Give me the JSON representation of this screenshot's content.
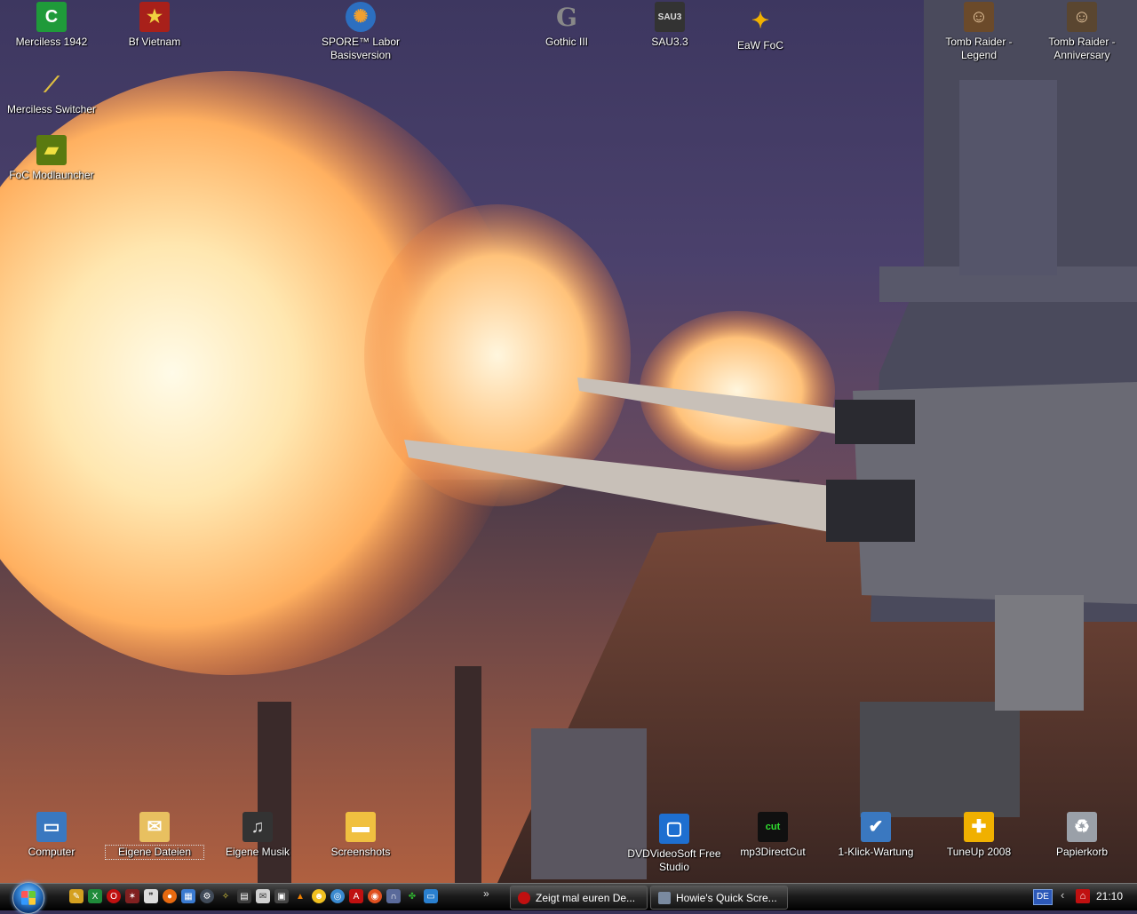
{
  "desktop": {
    "icons_top": [
      {
        "label": "Merciless 1942",
        "icon": "merciless-icon",
        "color": "#1f9a3a"
      },
      {
        "label": "Bf Vietnam",
        "icon": "battlefield-star-icon",
        "color": "#a8201a"
      },
      {
        "label": "SPORE™ Labor Basisversion",
        "icon": "spore-icon",
        "color": "#2c6fc0"
      },
      {
        "label": "Gothic III",
        "icon": "gothic-icon",
        "color": "#555555"
      },
      {
        "label": "SAU3.3",
        "icon": "sau3-icon",
        "color": "#333333"
      },
      {
        "label": "EaW FoC",
        "icon": "eaw-foc-icon",
        "color": "#c89000"
      },
      {
        "label": "Tomb Raider - Legend",
        "icon": "lara-portrait-icon",
        "color": "#6b4a2a"
      },
      {
        "label": "Tomb Raider - Anniversary",
        "icon": "lara-portrait-icon",
        "color": "#5a4630"
      },
      {
        "label": "Merciless Switcher",
        "icon": "wand-icon",
        "color": "#2a2a2a"
      },
      {
        "label": "FoC Modlauncher",
        "icon": "modlauncher-icon",
        "color": "#5a7a10"
      }
    ],
    "icons_bottom": [
      {
        "label": "Computer",
        "icon": "computer-icon",
        "color": "#3a78c0"
      },
      {
        "label": "Eigene Dateien",
        "icon": "documents-folder-icon",
        "color": "#e8c060"
      },
      {
        "label": "Eigene Musik",
        "icon": "music-icon",
        "color": "#333333"
      },
      {
        "label": "Screenshots",
        "icon": "folder-icon",
        "color": "#f0c040"
      },
      {
        "label": "DVDVideoSoft Free Studio",
        "icon": "dvdvideosoft-icon",
        "color": "#1e6fd0"
      },
      {
        "label": "mp3DirectCut",
        "icon": "mp3directcut-icon",
        "color": "#101010"
      },
      {
        "label": "1-Klick-Wartung",
        "icon": "maintenance-icon",
        "color": "#3a78c0"
      },
      {
        "label": "TuneUp 2008",
        "icon": "tuneup-icon",
        "color": "#f0b000"
      },
      {
        "label": "Papierkorb",
        "icon": "recycle-bin-icon",
        "color": "#9aa0a8"
      }
    ]
  },
  "taskbar": {
    "quicklaunch": [
      {
        "icon": "pencil-icon",
        "color": "#d4a020"
      },
      {
        "icon": "excel-icon",
        "color": "#1f8a3a"
      },
      {
        "icon": "opera-icon",
        "color": "#c01010"
      },
      {
        "icon": "game-icon",
        "color": "#802020"
      },
      {
        "icon": "chat-icon",
        "color": "#dddddd"
      },
      {
        "icon": "firefox-icon",
        "color": "#e86a10"
      },
      {
        "icon": "paint-icon",
        "color": "#3a7ad0"
      },
      {
        "icon": "steam-icon",
        "color": "#404a58"
      },
      {
        "icon": "stars-icon",
        "color": "#e0d040"
      },
      {
        "icon": "presentation-icon",
        "color": "#3a3a3a"
      },
      {
        "icon": "mail-icon",
        "color": "#d0d0d0"
      },
      {
        "icon": "film-icon",
        "color": "#444444"
      },
      {
        "icon": "vlc-icon",
        "color": "#f08000"
      },
      {
        "icon": "msn-icon",
        "color": "#f0c020"
      },
      {
        "icon": "browser-icon",
        "color": "#3a8ad0"
      },
      {
        "icon": "avira-icon",
        "color": "#c01010"
      },
      {
        "icon": "burn-icon",
        "color": "#e05020"
      },
      {
        "icon": "headphones-icon",
        "color": "#5a6a9a"
      },
      {
        "icon": "clover-icon",
        "color": "#30b030"
      },
      {
        "icon": "desktop-icon",
        "color": "#2a80d0"
      }
    ],
    "more": "»",
    "tasks": [
      {
        "label": "Zeigt mal euren De...",
        "icon": "opera-icon",
        "color": "#c01010"
      },
      {
        "label": "Howie's Quick Scre...",
        "icon": "camera-icon",
        "color": "#7a8aa0"
      }
    ],
    "language": "DE",
    "tray_arrow": "‹",
    "clock": "21:10"
  }
}
